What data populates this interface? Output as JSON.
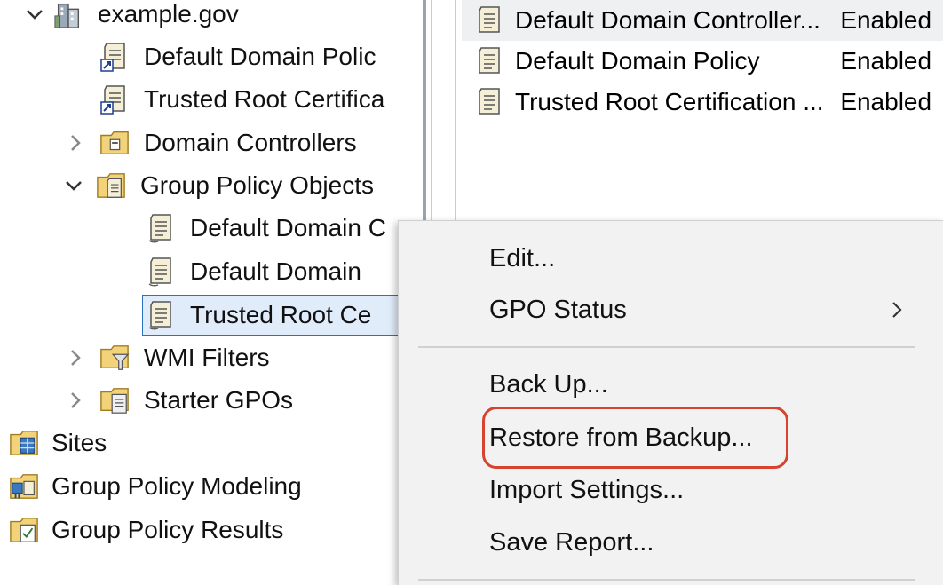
{
  "tree": {
    "items": [
      {
        "label": "example.gov",
        "icon": "domain-icon",
        "expander": "expanded"
      },
      {
        "label": "Default Domain Polic",
        "icon": "gpo-link-icon"
      },
      {
        "label": "Trusted Root Certifica",
        "icon": "gpo-link-icon"
      },
      {
        "label": "Domain Controllers",
        "icon": "ou-icon",
        "expander": "collapsed"
      },
      {
        "label": "Group Policy Objects",
        "icon": "gpo-folder-icon",
        "expander": "expanded"
      },
      {
        "label": "Default Domain C",
        "icon": "gpo-icon"
      },
      {
        "label": "Default Domain",
        "icon": "gpo-icon"
      },
      {
        "label": "Trusted Root Ce",
        "icon": "gpo-icon",
        "selected": true
      },
      {
        "label": "WMI Filters",
        "icon": "wmi-folder-icon",
        "expander": "collapsed"
      },
      {
        "label": "Starter GPOs",
        "icon": "starter-folder-icon",
        "expander": "collapsed"
      },
      {
        "label": "Sites",
        "icon": "sites-icon"
      },
      {
        "label": "Group Policy Modeling",
        "icon": "modeling-icon"
      },
      {
        "label": "Group Policy Results",
        "icon": "results-icon"
      }
    ]
  },
  "list": {
    "rows": [
      {
        "name": "Default Domain Controller...",
        "status": "Enabled",
        "highlighted": true
      },
      {
        "name": "Default Domain Policy",
        "status": "Enabled"
      },
      {
        "name": "Trusted Root Certification ...",
        "status": "Enabled"
      }
    ]
  },
  "context_menu": {
    "items": [
      {
        "label": "Edit..."
      },
      {
        "label": "GPO Status",
        "submenu": true
      },
      {
        "label": "Back Up..."
      },
      {
        "label": "Restore from Backup...",
        "emphasized": true
      },
      {
        "label": "Import Settings..."
      },
      {
        "label": "Save Report..."
      }
    ]
  },
  "colors": {
    "highlight_box": "#d6432f",
    "selection": "#e1ecfb",
    "menu_bg": "#f2f2f2"
  }
}
